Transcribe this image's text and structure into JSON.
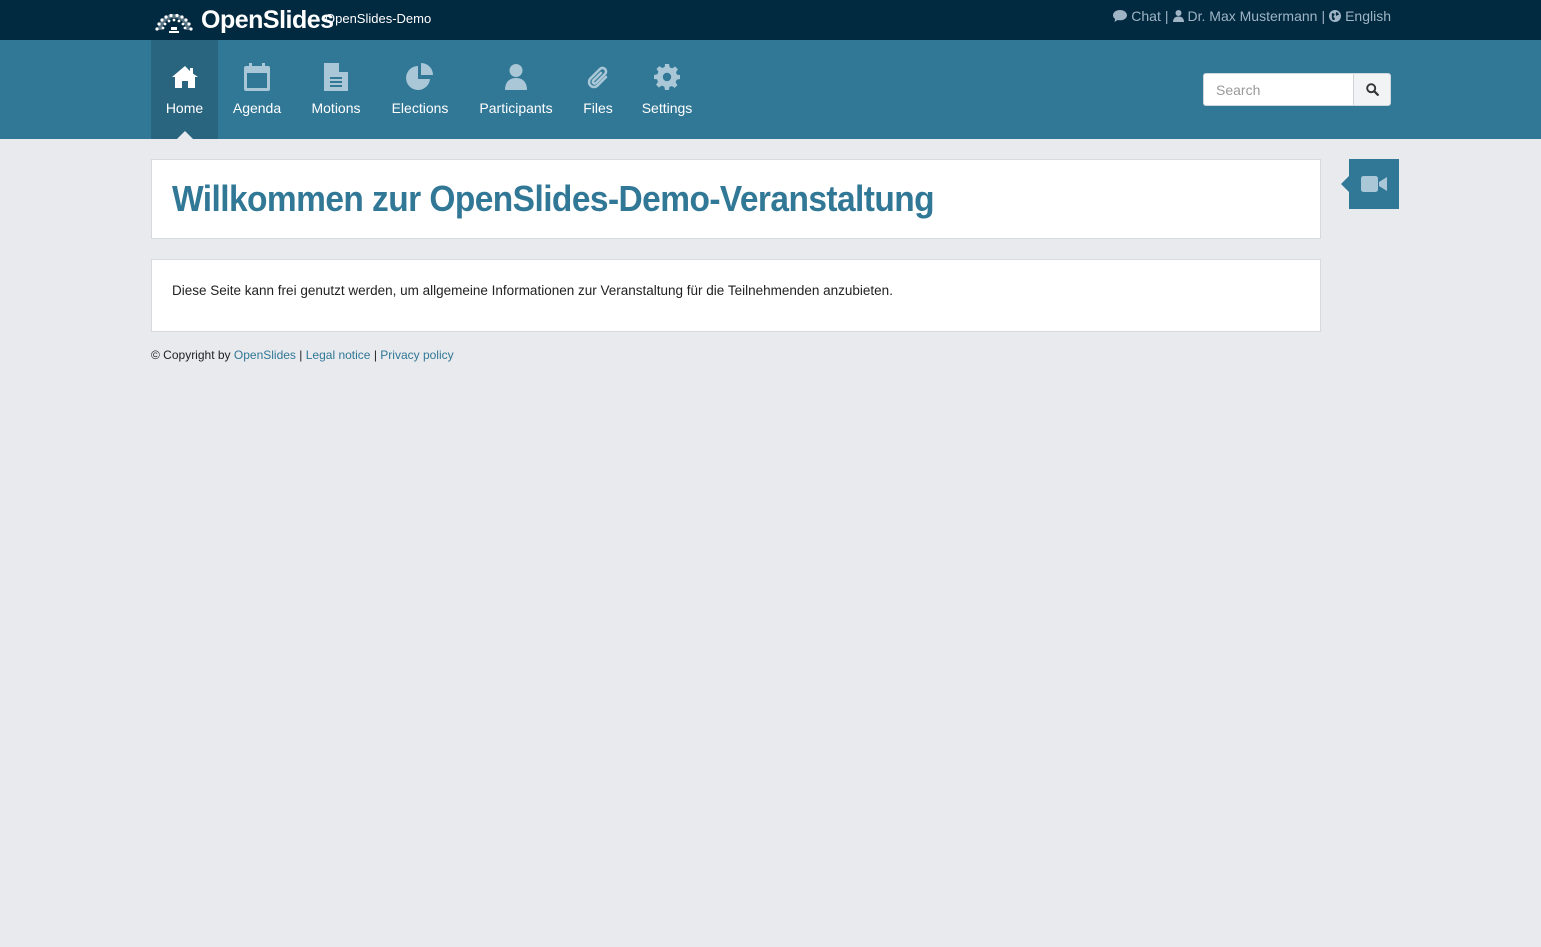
{
  "app": {
    "logo_text": "OpenSlides",
    "event_name": "OpenSlides-Demo"
  },
  "usermenu": {
    "chat_label": "Chat",
    "user_label": "Dr. Max Mustermann",
    "language_label": "English",
    "separator": "|"
  },
  "nav": {
    "items": [
      {
        "label": "Home",
        "icon": "home-icon",
        "active": true
      },
      {
        "label": "Agenda",
        "icon": "calendar-icon"
      },
      {
        "label": "Motions",
        "icon": "document-icon"
      },
      {
        "label": "Elections",
        "icon": "pie-chart-icon"
      },
      {
        "label": "Participants",
        "icon": "user-icon"
      },
      {
        "label": "Files",
        "icon": "paperclip-icon"
      },
      {
        "label": "Settings",
        "icon": "gear-icon"
      }
    ]
  },
  "search": {
    "placeholder": "Search"
  },
  "page": {
    "title": "Willkommen zur OpenSlides-Demo-Veranstaltung",
    "body": "Diese Seite kann frei genutzt werden, um allgemeine Informationen zur Veranstaltung für die Teilnehmenden anzubieten."
  },
  "footer": {
    "copyright_prefix": "© Copyright by",
    "openslides_link": "OpenSlides",
    "legal_link": "Legal notice",
    "privacy_link": "Privacy policy",
    "separator": "|"
  },
  "colors": {
    "topbar": "#012940",
    "navbar": "#317796",
    "nav_active": "#2a6580",
    "background": "#e8eaed",
    "accent": "#317796"
  }
}
